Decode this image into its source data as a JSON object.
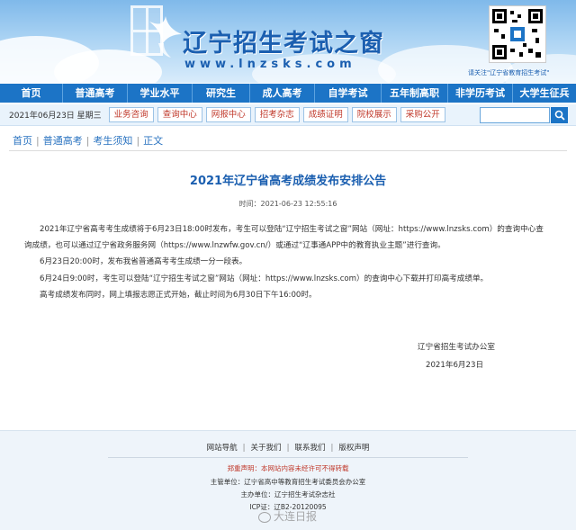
{
  "banner": {
    "title": "辽宁招生考试之窗",
    "url": "www.lnzsks.com",
    "qr_caption": "请关注\"辽宁省教育招生考试\""
  },
  "nav": {
    "items": [
      "首页",
      "普通高考",
      "学业水平",
      "研究生",
      "成人高考",
      "自学考试",
      "五年制高职",
      "非学历考试",
      "大学生征兵"
    ]
  },
  "subbar": {
    "date": "2021年06月23日 星期三",
    "links": [
      "业务咨询",
      "查询中心",
      "网报中心",
      "招考杂志",
      "成绩证明",
      "院校展示",
      "采购公开"
    ],
    "search_placeholder": ""
  },
  "breadcrumb": [
    "首页",
    "普通高考",
    "考生须知",
    "正文"
  ],
  "article": {
    "title": "2021年辽宁省高考成绩发布安排公告",
    "time": "时间：2021-06-23 12:55:16",
    "paragraphs": [
      "2021年辽宁省高考考生成绩将于6月23日18:00时发布，考生可以登陆“辽宁招生考试之窗”网站（网址：https://www.lnzsks.com）的查询中心查",
      "询成绩，也可以通过辽宁省政务服务网（https://www.lnzwfw.gov.cn/）或通过“辽事通APP中的教育执业主题”进行查询。",
      "6月23日20:00时，发布我省普通高考考生成绩一分一段表。",
      "6月24日9:00时，考生可以登陆“辽宁招生考试之窗”网站（网址：https://www.lnzsks.com）的查询中心下载并打印高考成绩单。",
      "高考成绩发布同时，网上填报志愿正式开始，截止时间为6月30日下午16:00时。"
    ],
    "sign_org": "辽宁省招生考试办公室",
    "sign_date": "2021年6月23日"
  },
  "footer": {
    "links": [
      "网站导航",
      "关于我们",
      "联系我们",
      "版权声明"
    ],
    "notice_label": "郑重声明：",
    "notice_text": "本网站内容未经许可不得转载",
    "sponsor": "主管单位：辽宁省高中等教育招生考试委员会办公室",
    "host": "主办单位：辽宁招生考试杂志社",
    "icp": "ICP证：辽B2-20120095"
  },
  "watermark": "大连日报",
  "colors": {
    "nav_blue": "#1c74c6",
    "title_blue": "#1b5fb0",
    "link_red": "#c0392b"
  }
}
